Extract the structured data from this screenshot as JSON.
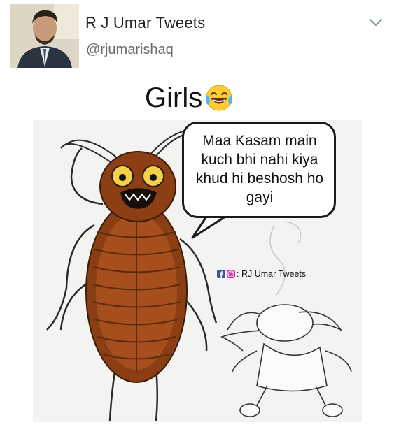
{
  "tweet": {
    "author_name": "R J Umar Tweets",
    "author_handle": "@rjumarishaq",
    "menu_icon": "chevron-down-icon",
    "text": "Girls",
    "emoji": "laughing-with-tears-emoji"
  },
  "meme": {
    "speech_bubble_lines": [
      "Maa Kasam main",
      "kuch bhi nahi kiya",
      "khud hi beshosh ho",
      "gayi"
    ],
    "watermark": ": RJ Umar Tweets",
    "watermark_icons": [
      "facebook-icon",
      "instagram-icon"
    ]
  },
  "colors": {
    "text_primary": "#222222",
    "text_secondary": "#6b6b6b",
    "chevron": "#8899a6"
  }
}
